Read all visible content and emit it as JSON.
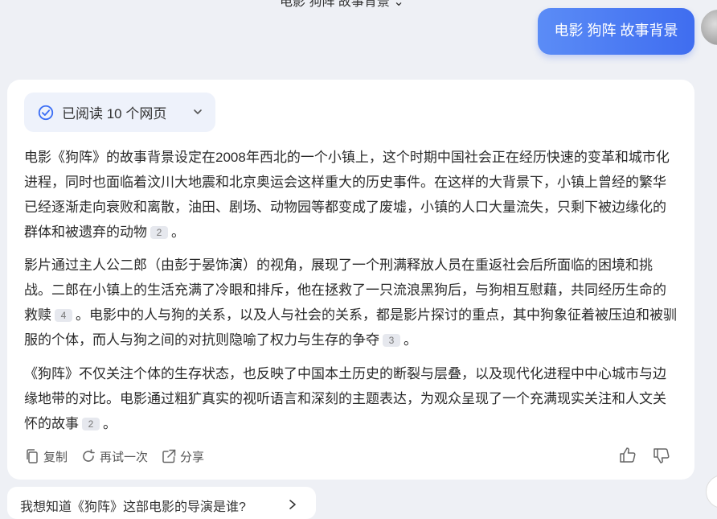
{
  "header": {
    "truncated_title": "电影 狗阵 故事背景"
  },
  "user_message": {
    "text": "电影 狗阵 故事背景"
  },
  "answer": {
    "reading_status": "已阅读 10 个网页",
    "paragraphs": [
      {
        "text": "电影《狗阵》的故事背景设定在2008年西北的一个小镇上，这个时期中国社会正在经历快速的变革和城市化进程，同时也面临着汶川大地震和北京奥运会这样重大的历史事件。在这样的大背景下，小镇上曾经的繁华已经逐渐走向衰败和离散，油田、剧场、动物园等都变成了废墟，小镇的人口大量流失，只剩下被边缘化的群体和被遗弃的动物",
        "cite": "2",
        "tail": "。"
      },
      {
        "text": "影片通过主人公二郎（由彭于晏饰演）的视角，展现了一个刑满释放人员在重返社会后所面临的困境和挑战。二郎在小镇上的生活充满了冷眼和排斥，他在拯救了一只流浪黑狗后，与狗相互慰藉，共同经历生命的救赎",
        "cite": "4",
        "mid": "。电影中的人与狗的关系，以及人与社会的关系，都是影片探讨的重点，其中狗象征着被压迫和被驯服的个体，而人与狗之间的对抗则隐喻了权力与生存的争夺",
        "cite2": "3",
        "tail": "。"
      },
      {
        "text": "《狗阵》不仅关注个体的生存状态，也反映了中国本土历史的断裂与层叠，以及现代化进程中中心城市与边缘地带的对比。电影通过粗犷真实的视听语言和深刻的主题表达，为观众呈现了一个充满现实关注和人文关怀的故事",
        "cite": "2",
        "tail": "。"
      }
    ],
    "actions": {
      "copy": "复制",
      "retry": "再试一次",
      "share": "分享"
    }
  },
  "suggestion": {
    "text": "我想知道《狗阵》这部电影的导演是谁?"
  },
  "colors": {
    "accent": "#3f6df0",
    "check": "#3b6ef5"
  },
  "icons": [
    "check-circle-icon",
    "chevron-down-icon",
    "copy-icon",
    "retry-icon",
    "share-icon",
    "thumbs-up-icon",
    "thumbs-down-icon",
    "arrow-right-icon"
  ]
}
